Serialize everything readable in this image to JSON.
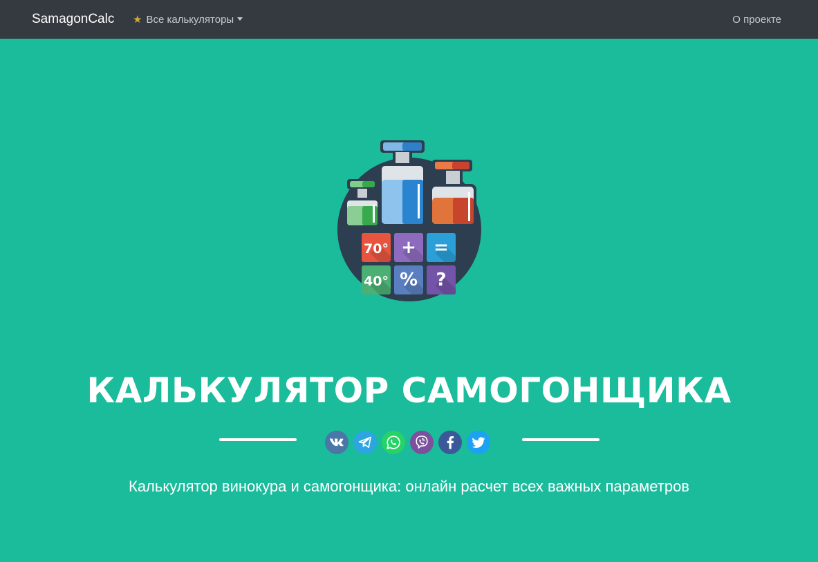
{
  "navbar": {
    "brand": "SamagonCalc",
    "calculators_menu": {
      "label": "Все калькуляторы",
      "icon": "star-icon"
    },
    "about_link": "О проекте"
  },
  "hero": {
    "logo": {
      "tiles": [
        {
          "text": "70°",
          "color": "#e8553f"
        },
        {
          "text": "+",
          "color": "#8e6bbf"
        },
        {
          "text": "=",
          "color": "#2a9fd8"
        },
        {
          "text": "40°",
          "color": "#4caf73"
        },
        {
          "text": "%",
          "color": "#5a7fc0"
        },
        {
          "text": "?",
          "color": "#7454a8"
        }
      ]
    },
    "title": "КАЛЬКУЛЯТОР САМОГОНЩИКА",
    "share_buttons": [
      {
        "name": "vk",
        "icon": "vk-icon",
        "color": "#4a76a8"
      },
      {
        "name": "telegram",
        "icon": "telegram-icon",
        "color": "#2ca5e0"
      },
      {
        "name": "whatsapp",
        "icon": "whatsapp-icon",
        "color": "#25d366"
      },
      {
        "name": "viber",
        "icon": "viber-icon",
        "color": "#7b519d"
      },
      {
        "name": "facebook",
        "icon": "facebook-icon",
        "color": "#3b5998"
      },
      {
        "name": "twitter",
        "icon": "twitter-icon",
        "color": "#1da1f2"
      }
    ],
    "subtitle": "Калькулятор винокура и самогонщика: онлайн расчет всех важных параметров"
  },
  "colors": {
    "navbar_bg": "#343a40",
    "hero_bg": "#1abc9c",
    "logo_circle": "#2c3e50"
  }
}
